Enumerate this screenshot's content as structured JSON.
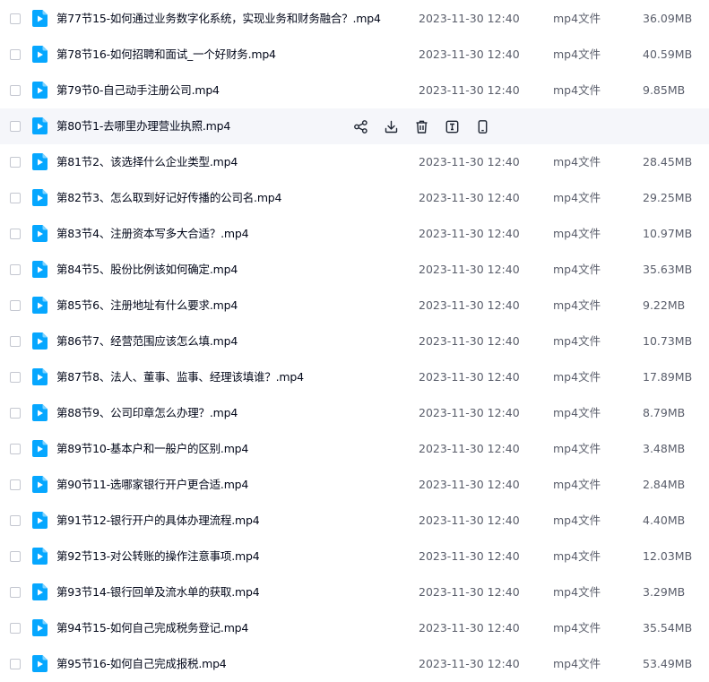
{
  "colors": {
    "accent": "#06a7ff",
    "hover_row": "#f5f6fa",
    "text_primary": "#03081a",
    "text_secondary": "#5a5e6b",
    "icon_action": "#1f2633"
  },
  "file_icon": "video-file-icon",
  "hover_actions": [
    {
      "name": "share-icon"
    },
    {
      "name": "download-icon"
    },
    {
      "name": "delete-icon"
    },
    {
      "name": "text-extract-icon"
    },
    {
      "name": "mobile-icon"
    }
  ],
  "files": [
    {
      "name": "第77节15-如何通过业务数字化系统，实现业务和财务融合？.mp4",
      "date": "2023-11-30 12:40",
      "type": "mp4文件",
      "size": "36.09MB"
    },
    {
      "name": "第78节16-如何招聘和面试_一个好财务.mp4",
      "date": "2023-11-30 12:40",
      "type": "mp4文件",
      "size": "40.59MB"
    },
    {
      "name": "第79节0-自己动手注册公司.mp4",
      "date": "2023-11-30 12:40",
      "type": "mp4文件",
      "size": "9.85MB"
    },
    {
      "name": "第80节1-去哪里办理营业执照.mp4",
      "date": "",
      "type": "",
      "size": "",
      "hovered": true
    },
    {
      "name": "第81节2、该选择什么企业类型.mp4",
      "date": "2023-11-30 12:40",
      "type": "mp4文件",
      "size": "28.45MB"
    },
    {
      "name": "第82节3、怎么取到好记好传播的公司名.mp4",
      "date": "2023-11-30 12:40",
      "type": "mp4文件",
      "size": "29.25MB"
    },
    {
      "name": "第83节4、注册资本写多大合适？.mp4",
      "date": "2023-11-30 12:40",
      "type": "mp4文件",
      "size": "10.97MB"
    },
    {
      "name": "第84节5、股份比例该如何确定.mp4",
      "date": "2023-11-30 12:40",
      "type": "mp4文件",
      "size": "35.63MB"
    },
    {
      "name": "第85节6、注册地址有什么要求.mp4",
      "date": "2023-11-30 12:40",
      "type": "mp4文件",
      "size": "9.22MB"
    },
    {
      "name": "第86节7、经营范围应该怎么填.mp4",
      "date": "2023-11-30 12:40",
      "type": "mp4文件",
      "size": "10.73MB"
    },
    {
      "name": "第87节8、法人、董事、监事、经理该填谁？.mp4",
      "date": "2023-11-30 12:40",
      "type": "mp4文件",
      "size": "17.89MB"
    },
    {
      "name": "第88节9、公司印章怎么办理？.mp4",
      "date": "2023-11-30 12:40",
      "type": "mp4文件",
      "size": "8.79MB"
    },
    {
      "name": "第89节10-基本户和一般户的区别.mp4",
      "date": "2023-11-30 12:40",
      "type": "mp4文件",
      "size": "3.48MB"
    },
    {
      "name": "第90节11-选哪家银行开户更合适.mp4",
      "date": "2023-11-30 12:40",
      "type": "mp4文件",
      "size": "2.84MB"
    },
    {
      "name": "第91节12-银行开户的具体办理流程.mp4",
      "date": "2023-11-30 12:40",
      "type": "mp4文件",
      "size": "4.40MB"
    },
    {
      "name": "第92节13-对公转账的操作注意事项.mp4",
      "date": "2023-11-30 12:40",
      "type": "mp4文件",
      "size": "12.03MB"
    },
    {
      "name": "第93节14-银行回单及流水单的获取.mp4",
      "date": "2023-11-30 12:40",
      "type": "mp4文件",
      "size": "3.29MB"
    },
    {
      "name": "第94节15-如何自己完成税务登记.mp4",
      "date": "2023-11-30 12:40",
      "type": "mp4文件",
      "size": "35.54MB"
    },
    {
      "name": "第95节16-如何自己完成报税.mp4",
      "date": "2023-11-30 12:40",
      "type": "mp4文件",
      "size": "53.49MB"
    }
  ]
}
